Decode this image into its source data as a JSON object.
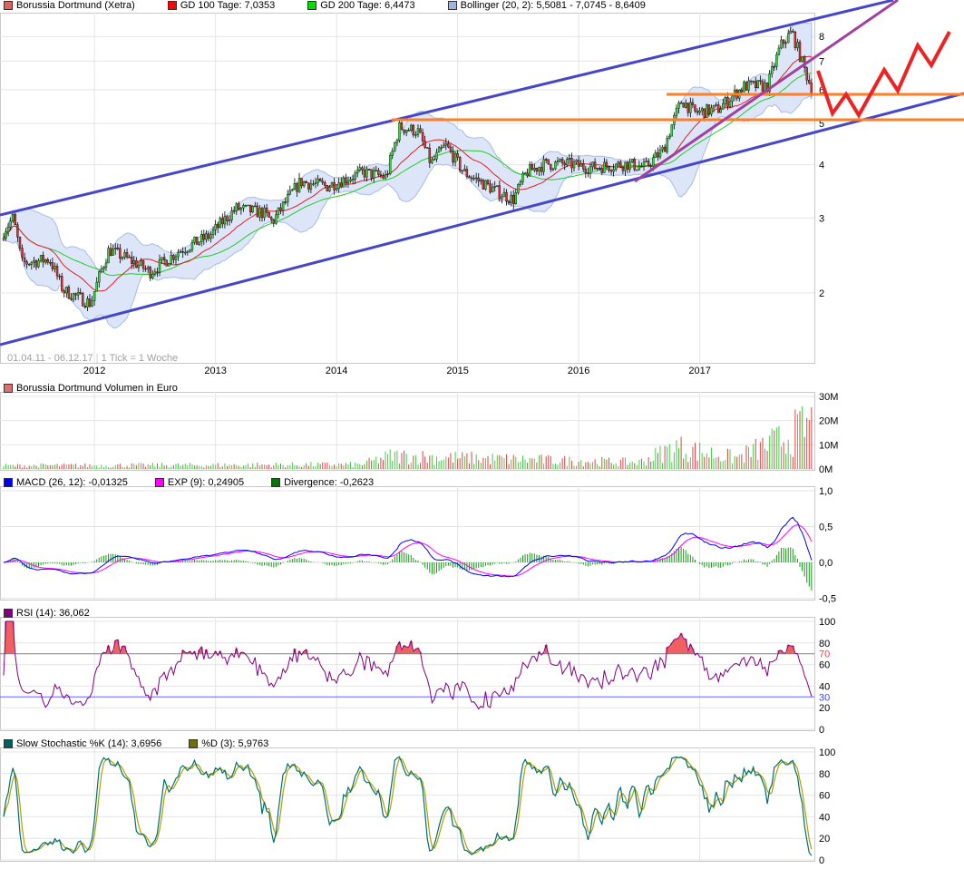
{
  "legend": {
    "price": [
      {
        "label": "Borussia Dortmund (Xetra)",
        "color": "#e06060"
      },
      {
        "label": "GD 100 Tage: 7,0353",
        "color": "#ff0000"
      },
      {
        "label": "GD 200 Tage: 6,4473",
        "color": "#00dd00"
      },
      {
        "label": "Bollinger (20, 2): 5,5081 - 7,0745 - 8,6409",
        "color": "#a0b4e0"
      }
    ],
    "volume": [
      {
        "label": "Borussia Dortmund Volumen in Euro",
        "color": "#e07070"
      }
    ],
    "macd": [
      {
        "label": "MACD (26, 12): -0,01325",
        "color": "#0000ff"
      },
      {
        "label": "EXP (9): 0,24905",
        "color": "#ff00ff"
      },
      {
        "label": "Divergence: -0,2623",
        "color": "#007700"
      }
    ],
    "rsi": [
      {
        "label": "RSI (14): 36,062",
        "color": "#800080"
      }
    ],
    "stoch": [
      {
        "label": "Slow Stochastic %K (14): 3,6956",
        "color": "#006060"
      },
      {
        "label": "%D (3): 5,9763",
        "color": "#707000"
      }
    ]
  },
  "info": {
    "range": "01.04.11 - 06.12.17",
    "tick": "1 Tick = 1 Woche"
  },
  "chart_data": {
    "type": "line",
    "title": "Borussia Dortmund (Xetra)",
    "x_ticks": [
      "2012",
      "2013",
      "2014",
      "2015",
      "2016",
      "2017"
    ],
    "x_range": [
      2011.25,
      2017.93
    ],
    "price_axis": {
      "scale": "log",
      "ticks": [
        "2",
        "3",
        "4",
        "5",
        "6",
        "7",
        "8"
      ]
    },
    "price_keypoints": [
      [
        2011.25,
        2.79
      ],
      [
        2011.33,
        3.0
      ],
      [
        2011.4,
        2.35
      ],
      [
        2011.63,
        2.4
      ],
      [
        2011.74,
        2.03
      ],
      [
        2011.97,
        1.89
      ],
      [
        2012.12,
        2.53
      ],
      [
        2012.34,
        2.35
      ],
      [
        2012.46,
        2.24
      ],
      [
        2012.72,
        2.53
      ],
      [
        2012.95,
        2.72
      ],
      [
        2013.17,
        3.16
      ],
      [
        2013.4,
        3.08
      ],
      [
        2013.47,
        2.93
      ],
      [
        2013.7,
        3.65
      ],
      [
        2013.92,
        3.56
      ],
      [
        2014.22,
        3.84
      ],
      [
        2014.41,
        3.74
      ],
      [
        2014.52,
        4.9
      ],
      [
        2014.67,
        4.8
      ],
      [
        2014.78,
        4.02
      ],
      [
        2014.9,
        4.44
      ],
      [
        2015.05,
        3.84
      ],
      [
        2015.31,
        3.48
      ],
      [
        2015.46,
        3.31
      ],
      [
        2015.57,
        3.84
      ],
      [
        2015.72,
        4.02
      ],
      [
        2015.91,
        4.02
      ],
      [
        2016.1,
        3.94
      ],
      [
        2016.4,
        4.02
      ],
      [
        2016.55,
        3.94
      ],
      [
        2016.7,
        4.34
      ],
      [
        2016.85,
        5.67
      ],
      [
        2016.96,
        5.3
      ],
      [
        2017.15,
        5.4
      ],
      [
        2017.37,
        6.12
      ],
      [
        2017.56,
        6.12
      ],
      [
        2017.67,
        7.63
      ],
      [
        2017.76,
        8.2
      ],
      [
        2017.86,
        6.75
      ],
      [
        2017.93,
        5.97
      ]
    ],
    "volume_axis": {
      "unit": "Euro",
      "ticks": [
        "0M",
        "10M",
        "20M",
        "30M"
      ]
    },
    "volume_keypoints_m": [
      [
        2011.25,
        1.5
      ],
      [
        2014.2,
        2
      ],
      [
        2014.45,
        6
      ],
      [
        2015.0,
        5
      ],
      [
        2016.5,
        3
      ],
      [
        2016.8,
        10
      ],
      [
        2017.3,
        5
      ],
      [
        2017.7,
        14
      ],
      [
        2017.9,
        20
      ]
    ],
    "macd_axis": {
      "ticks": [
        "-0,5",
        "0,0",
        "0,5",
        "1,0"
      ]
    },
    "rsi_axis": {
      "ticks": [
        "0",
        "20",
        "40",
        "60",
        "80",
        "100"
      ],
      "levels": [
        "70",
        "30"
      ]
    },
    "stoch_axis": {
      "ticks": [
        "0",
        "20",
        "40",
        "60",
        "80",
        "100"
      ]
    },
    "overlays": {
      "channel_color": "#4646c8",
      "support_color": "#ff7f27",
      "support_levels": [
        5.85,
        5.1
      ],
      "trend_color": "#a040a0",
      "forecast_color": "#ee2222"
    }
  }
}
